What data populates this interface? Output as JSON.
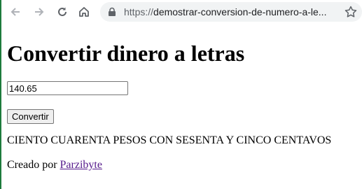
{
  "browser": {
    "url_scheme": "https://",
    "url_rest": "demostrar-conversion-de-numero-a-le...",
    "icons": [
      "back-arrow-icon",
      "forward-arrow-icon",
      "reload-icon",
      "home-icon",
      "lock-icon",
      "star-icon"
    ]
  },
  "page": {
    "heading": "Convertir dinero a letras",
    "amount_value": "140.65",
    "convert_label": "Convertir",
    "result_text": "CIENTO CUARENTA PESOS CON SESENTA Y CINCO CENTAVOS",
    "credit_prefix": "Creado por ",
    "credit_link": "Parzibyte",
    "link_color": "#551a8b"
  }
}
